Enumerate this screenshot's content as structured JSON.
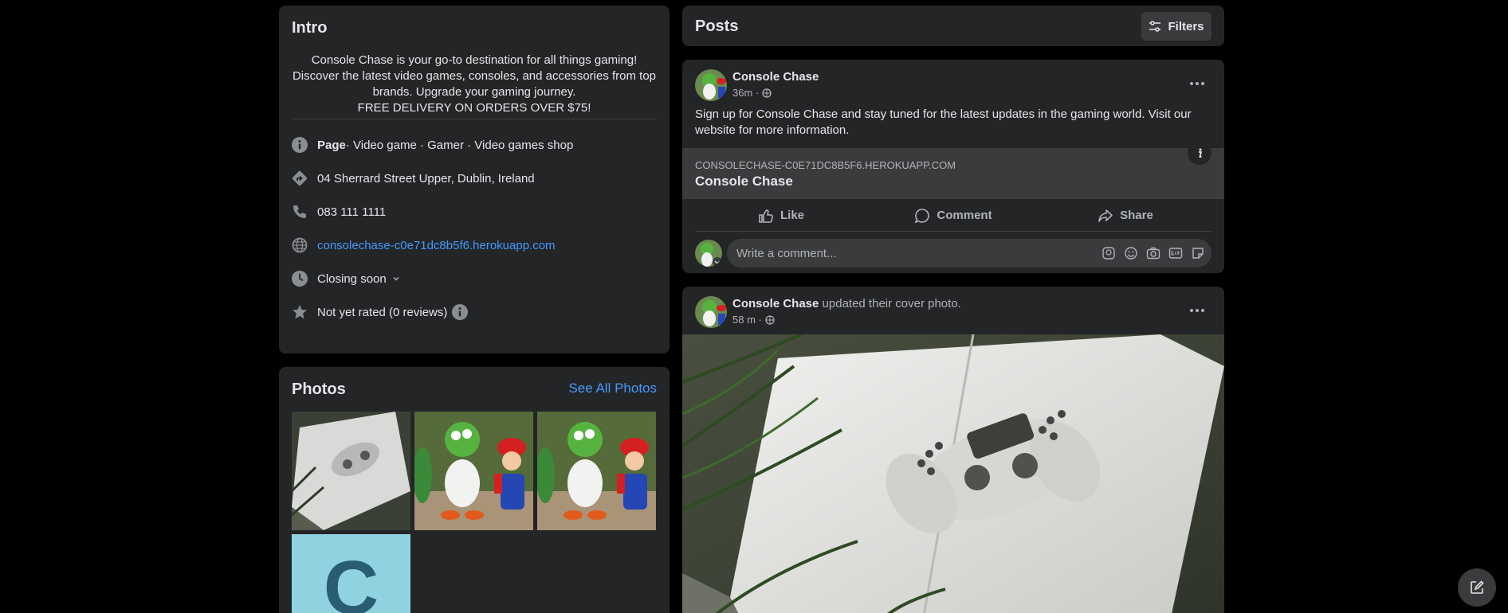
{
  "intro": {
    "title": "Intro",
    "description_lines": [
      "Console Chase is your go-to destination for all things gaming!",
      "Discover the latest video games, consoles, and accessories from top",
      "brands. Upgrade your gaming journey.",
      "FREE DELIVERY ON ORDERS OVER $75!"
    ],
    "category_prefix": "Page",
    "categories": " · Video game · Gamer · Video games shop",
    "address": "04 Sherrard Street Upper, Dublin, Ireland",
    "phone": "083 111 1111",
    "website": "consolechase-c0e71dc8b5f6.herokuapp.com",
    "hours": "Closing soon",
    "rating": "Not yet rated (0 reviews)"
  },
  "photos": {
    "title": "Photos",
    "see_all": "See All Photos",
    "letter_tile": "C"
  },
  "posts_header": {
    "title": "Posts",
    "filters": "Filters"
  },
  "post1": {
    "author": "Console Chase",
    "time": "36m ·",
    "text": "Sign up for Console Chase and stay tuned for the latest updates in the gaming world. Visit our website for more information.",
    "link_domain": "CONSOLECHASE-C0E71DC8B5F6.HEROKUAPP.COM",
    "link_title": "Console Chase",
    "like": "Like",
    "comment": "Comment",
    "share": "Share",
    "comment_placeholder": "Write a comment..."
  },
  "post2": {
    "author": "Console Chase",
    "action": " updated their cover photo.",
    "time": "58 m ·"
  },
  "colors": {
    "background": "#000000",
    "card": "#242526",
    "link": "#4599ff",
    "muted": "#b0b3b8"
  }
}
